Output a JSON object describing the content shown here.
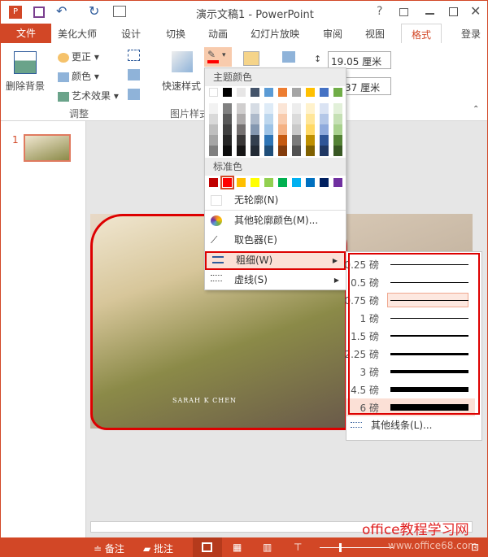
{
  "titlebar": {
    "title": "演示文稿1 - PowerPoint",
    "help": "?",
    "icons": [
      "powerpoint-icon",
      "save-icon",
      "undo-icon",
      "redo-icon",
      "presentation-icon"
    ]
  },
  "tabs": {
    "file": "文件",
    "items": [
      "美化大师",
      "设计",
      "切换",
      "动画",
      "幻灯片放映",
      "审阅",
      "视图",
      "格式",
      "登录"
    ],
    "active": "格式"
  },
  "ribbon": {
    "remove_bg": "删除背景",
    "corrections": "更正",
    "color": "颜色",
    "artistic": "艺术效果",
    "adjust_group": "调整",
    "quick_styles": "快速样式",
    "styles_group": "图片样式",
    "height": "19.05 厘米",
    "width": "37 厘米"
  },
  "outline_menu": {
    "theme_header": "主题颜色",
    "theme_colors": [
      "#ffffff",
      "#000000",
      "#e7e6e6",
      "#44546a",
      "#5b9bd5",
      "#ed7d31",
      "#a5a5a5",
      "#ffc000",
      "#4472c4",
      "#70ad47"
    ],
    "theme_shades": [
      [
        "#f2f2f2",
        "#d9d9d9",
        "#bfbfbf",
        "#a6a6a6",
        "#808080"
      ],
      [
        "#808080",
        "#595959",
        "#404040",
        "#262626",
        "#0d0d0d"
      ],
      [
        "#d0cece",
        "#aeabab",
        "#757171",
        "#3a3838",
        "#171616"
      ],
      [
        "#d6dce4",
        "#adb9ca",
        "#8497b0",
        "#333f4f",
        "#222a35"
      ],
      [
        "#deebf7",
        "#bdd7ee",
        "#9dc3e6",
        "#2e75b6",
        "#1f4e79"
      ],
      [
        "#fbe5d6",
        "#f8cbad",
        "#f4b183",
        "#c55a11",
        "#843c0c"
      ],
      [
        "#ededed",
        "#dbdbdb",
        "#c9c9c9",
        "#7b7b7b",
        "#525252"
      ],
      [
        "#fff2cc",
        "#ffe699",
        "#ffd966",
        "#bf9000",
        "#7f6000"
      ],
      [
        "#dae3f3",
        "#b4c7e7",
        "#8faadc",
        "#2f5597",
        "#203864"
      ],
      [
        "#e2f0d9",
        "#c5e0b4",
        "#a9d18e",
        "#548235",
        "#385723"
      ]
    ],
    "standard_header": "标准色",
    "standard_colors": [
      "#c00000",
      "#ff0000",
      "#ffc000",
      "#ffff00",
      "#92d050",
      "#00b050",
      "#00b0f0",
      "#0070c0",
      "#002060",
      "#7030a0"
    ],
    "selected_color": "#ff0000",
    "no_outline": "无轮廓(N)",
    "more_colors": "其他轮廓颜色(M)...",
    "eyedropper": "取色器(E)",
    "weight": "粗细(W)",
    "dashes": "虚线(S)"
  },
  "weight_submenu": {
    "items": [
      "0.25 磅",
      "0.5 磅",
      "0.75 磅",
      "1 磅",
      "1.5 磅",
      "2.25 磅",
      "3 磅",
      "4.5 磅",
      "6 磅"
    ],
    "weights_pt": [
      0.25,
      0.5,
      0.75,
      1,
      1.5,
      2.25,
      3,
      4.5,
      6
    ],
    "hovered": "0.75 磅",
    "selected": "6 磅",
    "more_lines": "其他线条(L)..."
  },
  "thumbnail": {
    "number": "1"
  },
  "photo": {
    "caption": "SARAH K CHEN"
  },
  "status": {
    "notes": "备注",
    "comments": "批注"
  },
  "watermark": {
    "text": "office教程学习网",
    "url": "www.office68.com"
  }
}
